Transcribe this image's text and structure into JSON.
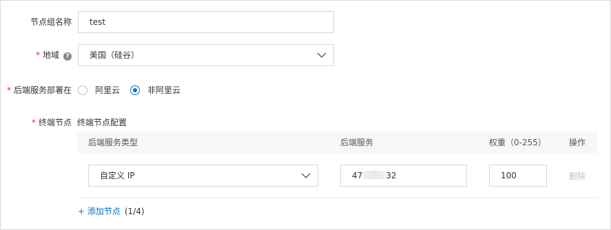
{
  "form": {
    "group_name": {
      "label": "节点组名称",
      "value": "test"
    },
    "region": {
      "label": "地域",
      "value": "美国（硅谷）",
      "help_icon": "question-circle-icon"
    },
    "backend_location": {
      "label": "后端服务部署在",
      "options": [
        {
          "label": "阿里云",
          "selected": false
        },
        {
          "label": "非阿里云",
          "selected": true
        }
      ]
    },
    "endpoint": {
      "label": "终端节点",
      "config_title": "终端节点配置",
      "columns": [
        "后端服务类型",
        "后端服务",
        "权重（0-255）",
        "操作"
      ],
      "rows": [
        {
          "type": "自定义 IP",
          "service_prefix": "47",
          "service_suffix": "32",
          "weight": "100",
          "action": "删除"
        }
      ],
      "add_label": "+ 添加节点",
      "add_count": "(1/4)"
    }
  },
  "colors": {
    "required": "#f5222d",
    "accent": "#0070cc",
    "disabled": "#c0c0c0"
  }
}
